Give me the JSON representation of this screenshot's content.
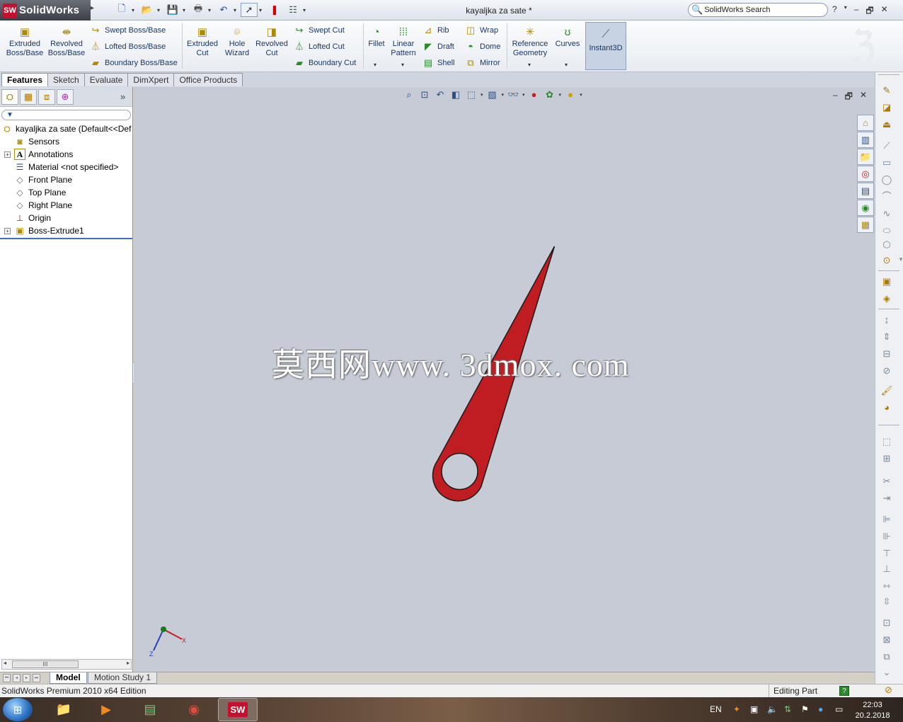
{
  "app": {
    "logo_badge": "SW",
    "logo_name": "SolidWorks",
    "doc_title": "kayaljka za sate *",
    "search_label": "SolidWorks Search",
    "help_label": "?",
    "win_min": "–",
    "win_restore": "🗗",
    "win_close": "✕"
  },
  "command_manager": {
    "big_buttons": [
      {
        "line1": "Extruded",
        "line2": "Boss/Base"
      },
      {
        "line1": "Revolved",
        "line2": "Boss/Base"
      },
      {
        "line1": "Extruded",
        "line2": "Cut"
      },
      {
        "line1": "Hole",
        "line2": "Wizard"
      },
      {
        "line1": "Revolved",
        "line2": "Cut"
      },
      {
        "line1": "Fillet",
        "line2": ""
      },
      {
        "line1": "Linear",
        "line2": "Pattern"
      },
      {
        "line1": "Reference",
        "line2": "Geometry"
      },
      {
        "line1": "Curves",
        "line2": ""
      }
    ],
    "small_buttons": {
      "swept_boss": "Swept Boss/Base",
      "lofted_boss": "Lofted Boss/Base",
      "boundary_boss": "Boundary Boss/Base",
      "swept_cut": "Swept Cut",
      "lofted_cut": "Lofted Cut",
      "boundary_cut": "Boundary Cut",
      "rib": "Rib",
      "draft": "Draft",
      "shell": "Shell",
      "wrap": "Wrap",
      "dome": "Dome",
      "mirror": "Mirror"
    },
    "instant3d": "Instant3D"
  },
  "tabs": [
    "Features",
    "Sketch",
    "Evaluate",
    "DimXpert",
    "Office Products"
  ],
  "feature_tree": {
    "more": "»",
    "root": "kayaljka za sate  (Default<<Def",
    "items": [
      {
        "label": "Sensors",
        "icon": "sensors-icon"
      },
      {
        "label": "Annotations",
        "icon": "annotations-icon"
      },
      {
        "label": "Material <not specified>",
        "icon": "material-icon"
      },
      {
        "label": "Front Plane",
        "icon": "plane-icon"
      },
      {
        "label": "Top Plane",
        "icon": "plane-icon"
      },
      {
        "label": "Right Plane",
        "icon": "plane-icon"
      },
      {
        "label": "Origin",
        "icon": "origin-icon"
      },
      {
        "label": "Boss-Extrude1",
        "icon": "boss-extrude-icon"
      }
    ],
    "scroll_thumb": "III"
  },
  "viewport": {
    "watermark": "莫西网www. 3dmox. com",
    "part_color": "#c01d23",
    "background": "#c6cbd6",
    "triad_x": "X",
    "triad_z": "Z"
  },
  "bottom_tabs": [
    "Model",
    "Motion Study 1"
  ],
  "status": {
    "left": "SolidWorks Premium 2010 x64 Edition",
    "editing": "Editing Part",
    "help": "?"
  },
  "taskbar": {
    "lang": "EN",
    "time": "22:03",
    "date": "20.2.2018",
    "sw_badge": "SW"
  }
}
